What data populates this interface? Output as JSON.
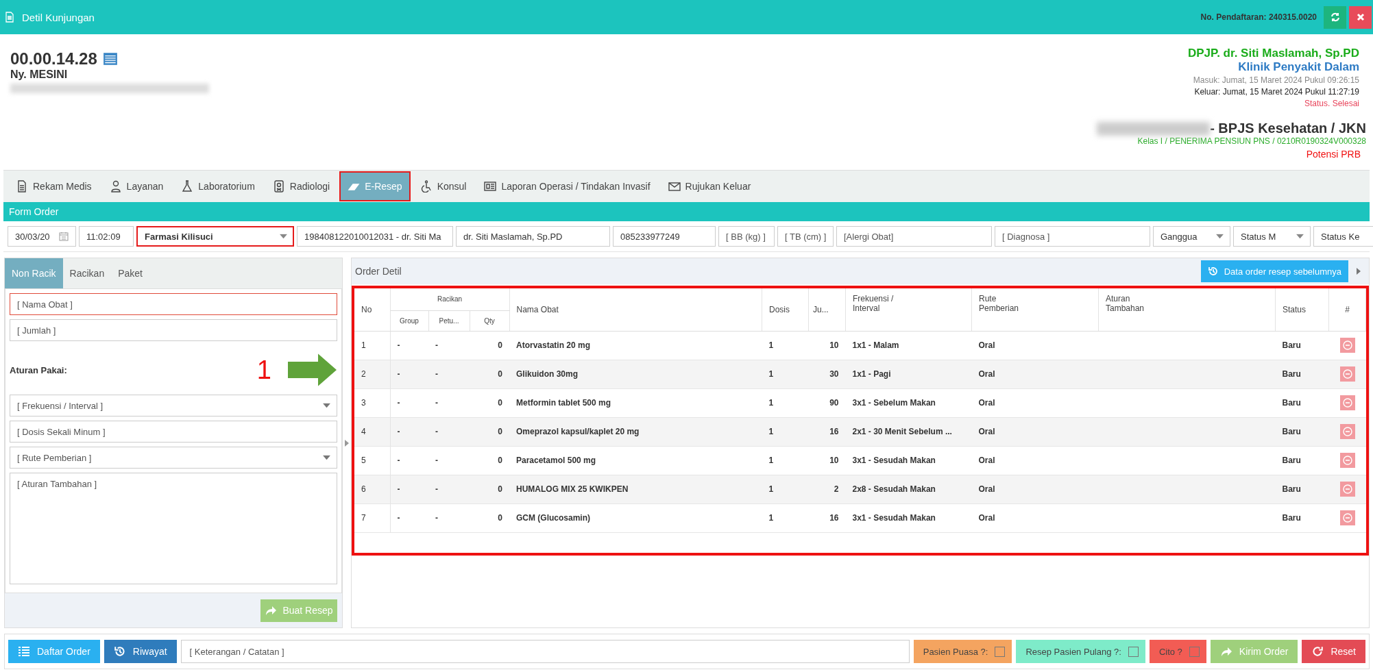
{
  "header": {
    "title": "Detil Kunjungan",
    "registration_no": "No. Pendaftaran: 240315.0020"
  },
  "patient": {
    "record_no": "00.00.14.28",
    "name": "Ny. MESINI"
  },
  "visit": {
    "doctor": "DPJP. dr. Siti Maslamah, Sp.PD",
    "clinic": "Klinik Penyakit Dalam",
    "masuk": "Masuk: Jumat, 15 Maret 2024 Pukul 09:26:15",
    "keluar": "Keluar: Jumat, 15 Maret 2024 Pukul 11:27:19",
    "status": "Status. Selesai",
    "insurance": "- BPJS Kesehatan / JKN",
    "class_info": "Kelas I / PENERIMA PENSIUN PNS / 0210R0190324V000328",
    "potensi": "Potensi PRB"
  },
  "nav_tabs": [
    {
      "label": "Rekam Medis",
      "selected": false,
      "highlighted": false
    },
    {
      "label": "Layanan",
      "selected": false,
      "highlighted": false
    },
    {
      "label": "Laboratorium",
      "selected": false,
      "highlighted": false
    },
    {
      "label": "Radiologi",
      "selected": false,
      "highlighted": false
    },
    {
      "label": "E-Resep",
      "selected": true,
      "highlighted": true
    },
    {
      "label": "Konsul",
      "selected": false,
      "highlighted": false
    },
    {
      "label": "Laporan Operasi / Tindakan Invasif",
      "selected": false,
      "highlighted": false
    },
    {
      "label": "Rujukan Keluar",
      "selected": false,
      "highlighted": false
    }
  ],
  "form_order": {
    "title": "Form Order",
    "fields": [
      {
        "kind": "date",
        "value": "30/03/20",
        "highlighted": false
      },
      {
        "kind": "text",
        "value": "11:02:09",
        "highlighted": false
      },
      {
        "kind": "select",
        "value": "Farmasi Kilisuci",
        "highlighted": true
      },
      {
        "kind": "text",
        "value": "198408122010012031 - dr. Siti Ma",
        "highlighted": false
      },
      {
        "kind": "text",
        "value": "dr. Siti Maslamah, Sp.PD",
        "highlighted": false
      },
      {
        "kind": "text",
        "value": "085233977249",
        "highlighted": false
      },
      {
        "kind": "text",
        "placeholder": "[ BB (kg) ]",
        "highlighted": false
      },
      {
        "kind": "text",
        "placeholder": "[ TB (cm) ]",
        "highlighted": false
      },
      {
        "kind": "text",
        "placeholder": "[Alergi Obat]",
        "highlighted": false
      },
      {
        "kind": "text",
        "placeholder": "[ Diagnosa ]",
        "highlighted": false
      },
      {
        "kind": "select",
        "value": "Ganggua",
        "highlighted": false
      },
      {
        "kind": "select",
        "value": "Status M",
        "highlighted": false
      },
      {
        "kind": "select",
        "value": "Status Ke",
        "highlighted": false
      }
    ]
  },
  "left_panel": {
    "tabs": [
      {
        "label": "Non Racik",
        "selected": true
      },
      {
        "label": "Racikan",
        "selected": false
      },
      {
        "label": "Paket",
        "selected": false
      }
    ],
    "fields": [
      {
        "kind": "text",
        "placeholder": "[ Nama Obat ]",
        "highlighted": true
      },
      {
        "kind": "text",
        "placeholder": "[ Jumlah ]",
        "highlighted": false
      },
      {
        "kind": "label",
        "text": "Aturan Pakai:"
      },
      {
        "kind": "select",
        "placeholder": "[ Frekuensi / Interval ]",
        "highlighted": false
      },
      {
        "kind": "text",
        "placeholder": "[ Dosis Sekali Minum ]",
        "highlighted": false
      },
      {
        "kind": "select",
        "placeholder": "[ Rute Pemberian ]",
        "highlighted": false
      },
      {
        "kind": "textarea",
        "placeholder": "[ Aturan Tambahan ]",
        "highlighted": false
      }
    ],
    "button": "Buat Resep"
  },
  "annotation": {
    "number": "1"
  },
  "order_detail": {
    "title": "Order Detil",
    "history_button": "Data order resep sebelumnya",
    "highlighted": true,
    "group_header": "Racikan",
    "columns": [
      "No",
      "Group",
      "Petu...",
      "Qty",
      "Nama Obat",
      "Dosis",
      "Ju...",
      "Frekuensi /\nInterval",
      "Rute\nPemberian",
      "Aturan\nTambahan",
      "Status",
      "#"
    ],
    "rows": [
      {
        "no": "1",
        "group": "-",
        "petunjuk": "-",
        "qty": "0",
        "nama": "Atorvastatin 20 mg",
        "dosis": "1",
        "jumlah": "10",
        "frekuensi": "1x1 - Malam",
        "rute": "Oral",
        "status": "Baru"
      },
      {
        "no": "2",
        "group": "-",
        "petunjuk": "-",
        "qty": "0",
        "nama": "Glikuidon 30mg",
        "dosis": "1",
        "jumlah": "30",
        "frekuensi": "1x1 - Pagi",
        "rute": "Oral",
        "status": "Baru"
      },
      {
        "no": "3",
        "group": "-",
        "petunjuk": "-",
        "qty": "0",
        "nama": "Metformin tablet 500 mg",
        "dosis": "1",
        "jumlah": "90",
        "frekuensi": "3x1 - Sebelum Makan",
        "rute": "Oral",
        "status": "Baru"
      },
      {
        "no": "4",
        "group": "-",
        "petunjuk": "-",
        "qty": "0",
        "nama": "Omeprazol kapsul/kaplet 20 mg",
        "dosis": "1",
        "jumlah": "16",
        "frekuensi": "2x1 - 30 Menit Sebelum ...",
        "rute": "Oral",
        "status": "Baru"
      },
      {
        "no": "5",
        "group": "-",
        "petunjuk": "-",
        "qty": "0",
        "nama": "Paracetamol 500 mg",
        "dosis": "1",
        "jumlah": "10",
        "frekuensi": "3x1 - Sesudah Makan",
        "rute": "Oral",
        "status": "Baru"
      },
      {
        "no": "6",
        "group": "-",
        "petunjuk": "-",
        "qty": "0",
        "nama": "HUMALOG MIX 25 KWIKPEN",
        "dosis": "1",
        "jumlah": "2",
        "frekuensi": "2x8 - Sesudah Makan",
        "rute": "Oral",
        "status": "Baru"
      },
      {
        "no": "7",
        "group": "-",
        "petunjuk": "-",
        "qty": "0",
        "nama": "GCM (Glucosamin)",
        "dosis": "1",
        "jumlah": "16",
        "frekuensi": "3x1 - Sesudah Makan",
        "rute": "Oral",
        "status": "Baru"
      }
    ]
  },
  "bottom_bar": {
    "daftar_button": "Daftar Order",
    "riwayat_button": "Riwayat",
    "note_placeholder": "[ Keterangan / Catatan ]",
    "checkboxes": [
      {
        "label": "Pasien Puasa ?:",
        "checked": false,
        "color": "#f4a460"
      },
      {
        "label": "Resep Pasien Pulang ?:",
        "checked": false,
        "color": "#7eebc9"
      },
      {
        "label": "Cito ?",
        "checked": false,
        "color": "#f25c54"
      }
    ],
    "kirim_button": "Kirim Order",
    "reset_button": "Reset"
  }
}
